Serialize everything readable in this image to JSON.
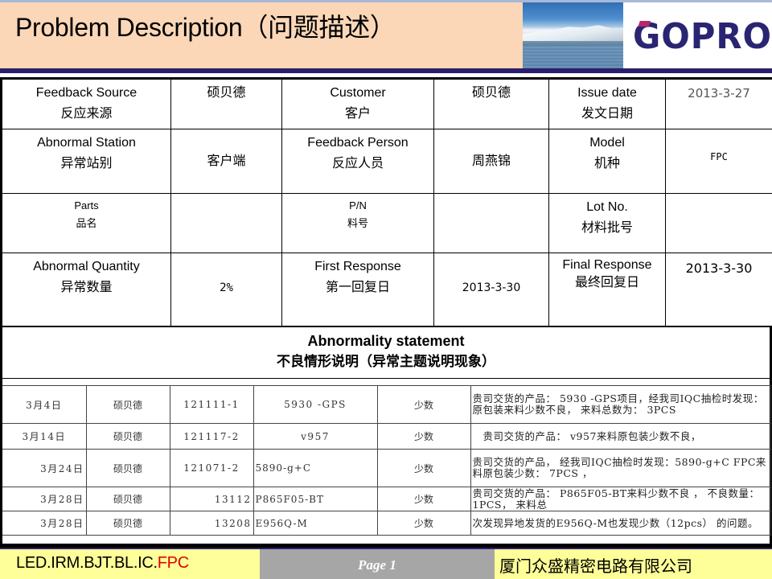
{
  "header": {
    "title": "Problem Description（问题描述）",
    "logo_text": "GOPRO"
  },
  "info": {
    "feedback_source": {
      "label_en": "Feedback Source",
      "label_cn": "反应来源",
      "value": "硕贝德"
    },
    "customer": {
      "label_en": "Customer",
      "label_cn": "客户",
      "value": "硕贝德"
    },
    "issue_date": {
      "label_en": "Issue date",
      "label_cn": "发文日期",
      "value": "2013-3-27"
    },
    "abnormal_station": {
      "label_en": "Abnormal Station",
      "label_cn": "异常站别",
      "value": "客户端"
    },
    "feedback_person": {
      "label_en": "Feedback Person",
      "label_cn": "反应人员",
      "value": "周燕锦"
    },
    "model": {
      "label_en": "Model",
      "label_cn": "机种",
      "value": "FPC"
    },
    "parts": {
      "label_en": "Parts",
      "label_cn": "品名",
      "value": ""
    },
    "pn": {
      "label_en": "P/N",
      "label_cn": "料号",
      "value": ""
    },
    "lot_no": {
      "label_en": "Lot No.",
      "label_cn": "材料批号",
      "value": ""
    },
    "abnormal_quantity": {
      "label_en": "Abnormal Quantity",
      "label_cn": "异常数量",
      "value": "2%"
    },
    "first_response": {
      "label_en": "First Response",
      "label_cn": "第一回复日",
      "value": "2013-3-30"
    },
    "final_response": {
      "label_en": "Final Response",
      "label_cn": "最终回复日",
      "value": "2013-3-30"
    }
  },
  "statement": {
    "title_en": "Abnormality statement",
    "title_cn": "不良情形说明（异常主题说明现象）"
  },
  "records": [
    {
      "date": "3月4日",
      "customer": "硕贝德",
      "pn": "121111-1",
      "model": "5930 -GPS",
      "type": "少数",
      "desc": "贵司交货的产品： 5930 -GPS项目，经我司IQC抽检时发现： 原包装来料少数不良， 来料总数为： 3PCS"
    },
    {
      "date": "3月14日",
      "customer": "硕贝德",
      "pn": "121117-2",
      "model": "v957",
      "type": "少数",
      "desc": "　贵司交货的产品： v957来料原包装少数不良，"
    },
    {
      "date": "3月24日",
      "customer": "硕贝德",
      "pn": "121071-2",
      "model": "5890-g+C",
      "type": "少数",
      "desc": "贵司交货的产品， 经我司IQC抽检时发现：5890-g+C FPC来料原包装少数： 7PCS ，"
    },
    {
      "date": "3月28日",
      "customer": "硕贝德",
      "pn": "13112",
      "model": "P865F05-BT",
      "type": "少数",
      "desc": " 贵司交货的产品： P865F05-BT来料少数不良 ， 不良数量： 1PCS， 来料总"
    },
    {
      "date": "3月28日",
      "customer": "硕贝德",
      "pn": "13208",
      "model": "E956Q-M",
      "type": "少数",
      "desc": "次发现异地发货的E956Q-M也发现少数（12pcs） 的问题。"
    }
  ],
  "footer": {
    "product_line_prefix": "LED.IRM.BJT.BL.IC.",
    "product_line_highlight": "FPC",
    "page_label": "Page 1",
    "company": "厦门众盛精密电路有限公司"
  },
  "colors": {
    "header_bg": "#fbd7b8",
    "header_rule": "#2b1f6b",
    "logo": "#2a2572",
    "footer_bg": "#ffff99",
    "footer_page_bg": "#a6a6a6",
    "highlight_red": "#e00000"
  }
}
